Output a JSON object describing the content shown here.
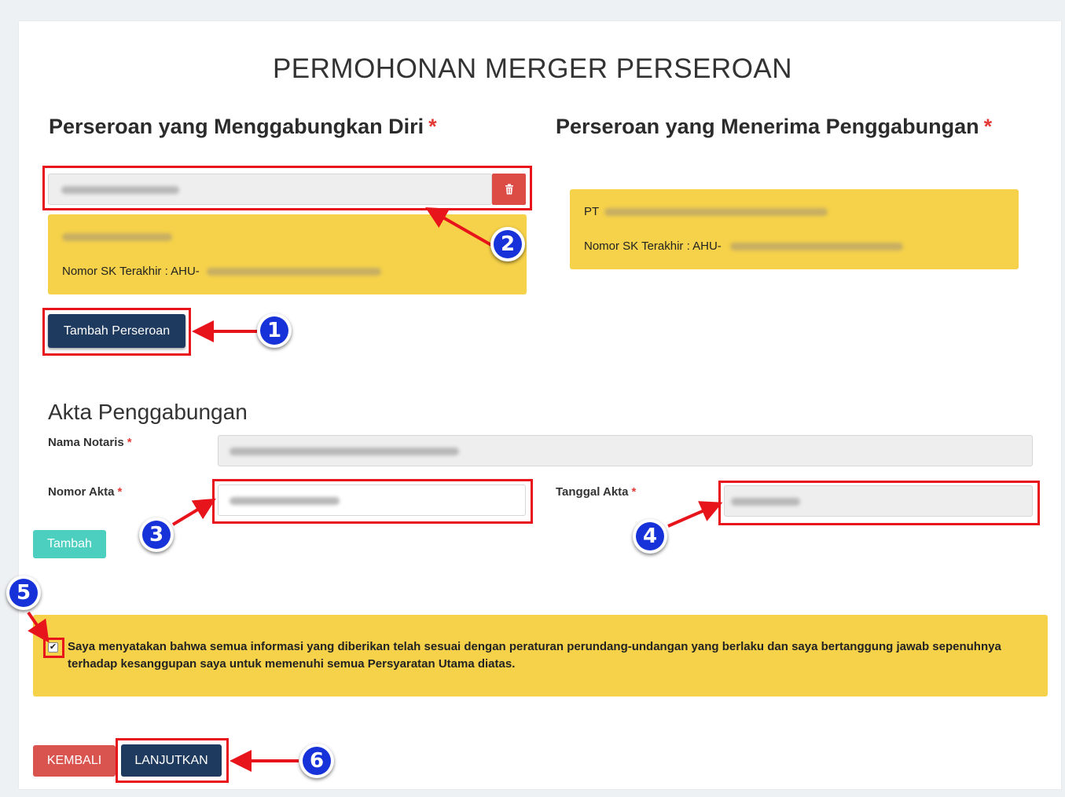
{
  "page_title": "PERMOHONAN MERGER PERSEROAN",
  "required_marker": "*",
  "left_section": {
    "title": "Perseroan yang Menggabungkan Diri",
    "company_card_label": "Nomor SK Terakhir : AHU-",
    "add_button": "Tambah Perseroan"
  },
  "right_section": {
    "title": "Perseroan yang Menerima Penggabungan",
    "company_prefix": "PT",
    "company_card_label": "Nomor SK Terakhir : AHU-"
  },
  "akta": {
    "title": "Akta Penggabungan",
    "nama_notaris_label": "Nama Notaris",
    "nomor_akta_label": "Nomor Akta",
    "tanggal_akta_label": "Tanggal Akta",
    "add_button": "Tambah"
  },
  "disclaimer": {
    "checked": true,
    "text": "Saya menyatakan bahwa semua informasi yang diberikan telah sesuai dengan peraturan perundang-undangan yang berlaku dan saya bertanggung jawab sepenuhnya terhadap kesanggupan saya untuk memenuhi semua Persyaratan Utama diatas."
  },
  "footer": {
    "back_button": "KEMBALI",
    "next_button": "LANJUTKAN"
  },
  "annotations": [
    "1",
    "2",
    "3",
    "4",
    "5",
    "6"
  ],
  "colors": {
    "navy": "#1f3a5f",
    "yellow_card": "#f6d24a",
    "danger": "#d9534f",
    "teal": "#4ccfbf",
    "highlight_red": "#e8141b",
    "badge_blue": "#1632d8"
  },
  "icons": {
    "delete": "trash-icon",
    "check": "checkmark-icon"
  }
}
